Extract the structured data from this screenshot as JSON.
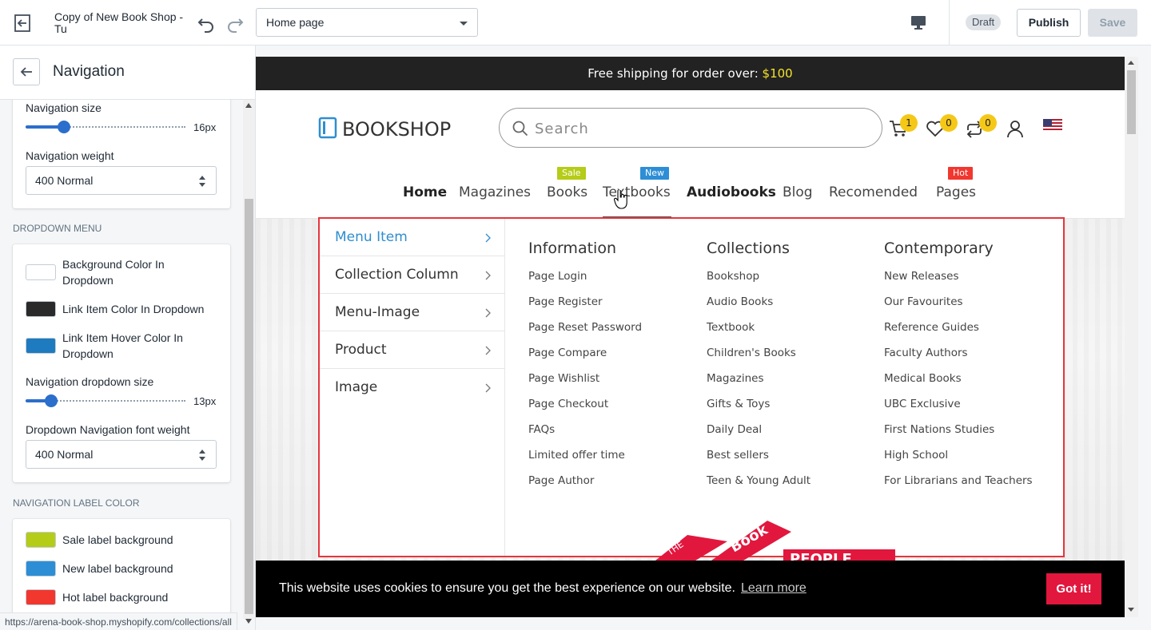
{
  "topbar": {
    "title": "Copy of New Book Shop - Tu",
    "page_select": "Home page",
    "draft_label": "Draft",
    "publish_label": "Publish",
    "save_label": "Save"
  },
  "sidebar": {
    "title": "Navigation",
    "nav_size_label": "Navigation size",
    "nav_size_value": "16px",
    "nav_size_fraction": 0.22,
    "nav_weight_label": "Navigation weight",
    "nav_weight_value": "400 Normal",
    "dropdown_section": "DROPDOWN MENU",
    "dropdown_colors": [
      {
        "label": "Background Color In Dropdown",
        "color": "#ffffff"
      },
      {
        "label": "Link Item Color In Dropdown",
        "color": "#2a2a2a"
      },
      {
        "label": "Link Item Hover Color In Dropdown",
        "color": "#1f7bbf"
      }
    ],
    "dropdown_size_label": "Navigation dropdown size",
    "dropdown_size_value": "13px",
    "dropdown_size_fraction": 0.13,
    "dropdown_weight_label": "Dropdown Navigation font weight",
    "dropdown_weight_value": "400 Normal",
    "label_color_section": "NAVIGATION LABEL COLOR",
    "label_colors": [
      {
        "label": "Sale label background",
        "color": "#b5cc18"
      },
      {
        "label": "New label background",
        "color": "#2d8ed6"
      },
      {
        "label": "Hot label background",
        "color": "#f2372f"
      }
    ],
    "status_url": "https://arena-book-shop.myshopify.com/collections/all"
  },
  "preview": {
    "announcement_text": "Free shipping for order over: ",
    "announcement_price": "$100",
    "logo_text": "BOOKSHOP",
    "search_placeholder": "Search",
    "cart_count": "1",
    "wishlist_count": "0",
    "compare_count": "0",
    "nav": [
      {
        "label": "Home",
        "bold": true
      },
      {
        "label": "Magazines"
      },
      {
        "label": "Books",
        "tag": "Sale",
        "tag_color": "#b5cc18"
      },
      {
        "label": "Textbooks",
        "tag": "New",
        "tag_color": "#2d8ed6"
      },
      {
        "label": "Audiobooks",
        "bold": true
      },
      {
        "label": "Blog"
      },
      {
        "label": "Recomended"
      },
      {
        "label": "Pages",
        "tag": "Hot",
        "tag_color": "#f2372f"
      }
    ],
    "mega_left": [
      "Menu Item",
      "Collection Column",
      "Menu-Image",
      "Product",
      "Image"
    ],
    "mega_columns": [
      {
        "title": "Information",
        "links": [
          "Page Login",
          "Page Register",
          "Page Reset Password",
          "Page Compare",
          "Page Wishlist",
          "Page Checkout",
          "FAQs",
          "Limited offer time",
          "Page Author"
        ]
      },
      {
        "title": "Collections",
        "links": [
          "Bookshop",
          "Audio Books",
          "Textbook",
          "Children's Books",
          "Magazines",
          "Gifts & Toys",
          "Daily Deal",
          "Best sellers",
          "Teen & Young Adult"
        ]
      },
      {
        "title": "Contemporary",
        "links": [
          "New Releases",
          "Our Favourites",
          "Reference Guides",
          "Faculty Authors",
          "Medical Books",
          "UBC Exclusive",
          "First Nations Studies",
          "High School",
          "For Librarians and Teachers"
        ]
      }
    ],
    "cookie_text": "This website uses cookies to ensure you get the best experience on our website.",
    "cookie_link": "Learn more",
    "cookie_button": "Got it!"
  }
}
